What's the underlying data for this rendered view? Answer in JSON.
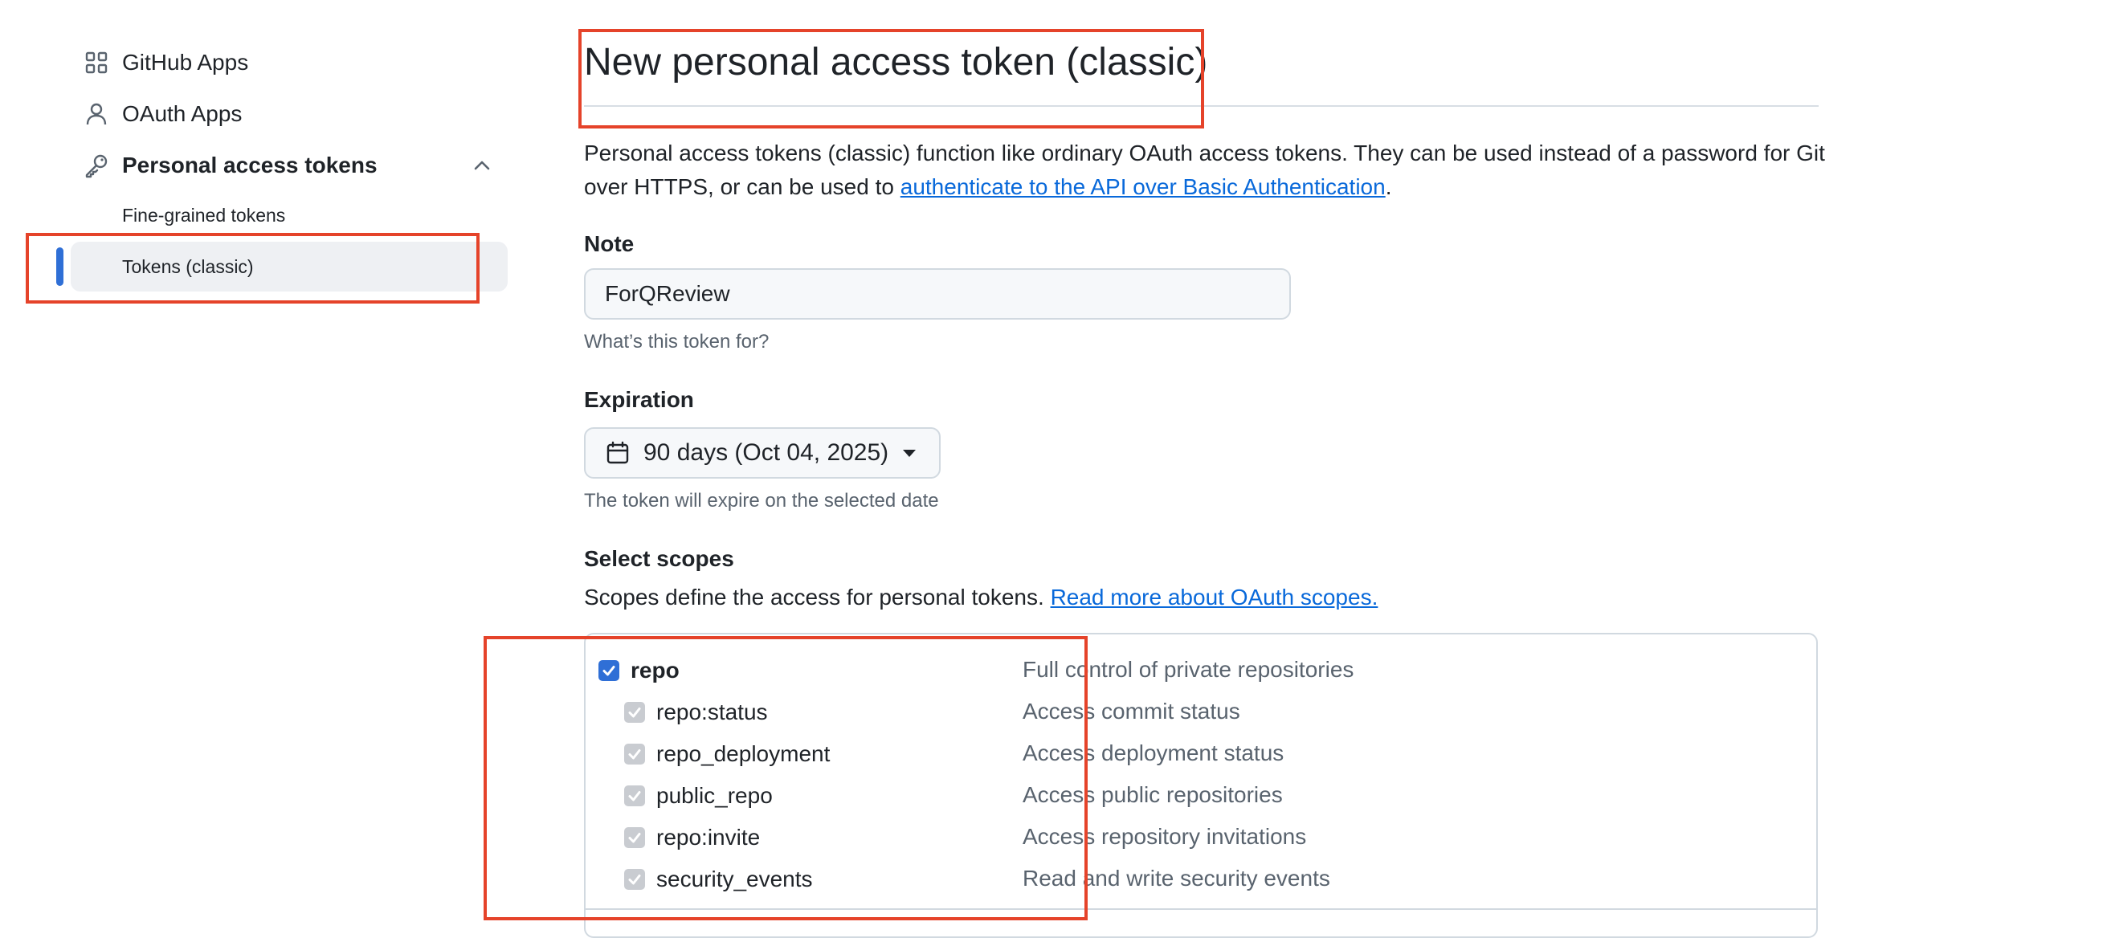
{
  "sidebar": {
    "items": [
      {
        "label": "GitHub Apps",
        "icon": "apps-grid-icon"
      },
      {
        "label": "OAuth Apps",
        "icon": "person-icon"
      },
      {
        "label": "Personal access tokens",
        "icon": "key-icon"
      }
    ],
    "subitems": [
      {
        "label": "Fine-grained tokens"
      },
      {
        "label": "Tokens (classic)",
        "selected": true
      }
    ]
  },
  "page": {
    "title": "New personal access token (classic)",
    "description_text": "Personal access tokens (classic) function like ordinary OAuth access tokens. They can be used instead of a password for Git over HTTPS, or can be used to ",
    "description_link": "authenticate to the API over Basic Authentication",
    "description_end": "."
  },
  "note": {
    "label": "Note",
    "value": "ForQReview",
    "hint": "What’s this token for?"
  },
  "expiration": {
    "label": "Expiration",
    "selected": "90 days (Oct 04, 2025)",
    "hint": "The token will expire on the selected date"
  },
  "scopes": {
    "label": "Select scopes",
    "description": "Scopes define the access for personal tokens. ",
    "link": "Read more about OAuth scopes.",
    "rows": [
      {
        "name": "repo",
        "description": "Full control of private repositories",
        "checked": true,
        "parent": true
      },
      {
        "name": "repo:status",
        "description": "Access commit status",
        "checked": true,
        "parent": false
      },
      {
        "name": "repo_deployment",
        "description": "Access deployment status",
        "checked": true,
        "parent": false
      },
      {
        "name": "public_repo",
        "description": "Access public repositories",
        "checked": true,
        "parent": false
      },
      {
        "name": "repo:invite",
        "description": "Access repository invitations",
        "checked": true,
        "parent": false
      },
      {
        "name": "security_events",
        "description": "Read and write security events",
        "checked": true,
        "parent": false
      }
    ]
  },
  "colors": {
    "accent": "#2f6fd6",
    "link": "#0969da",
    "annotation": "#e5432a"
  }
}
